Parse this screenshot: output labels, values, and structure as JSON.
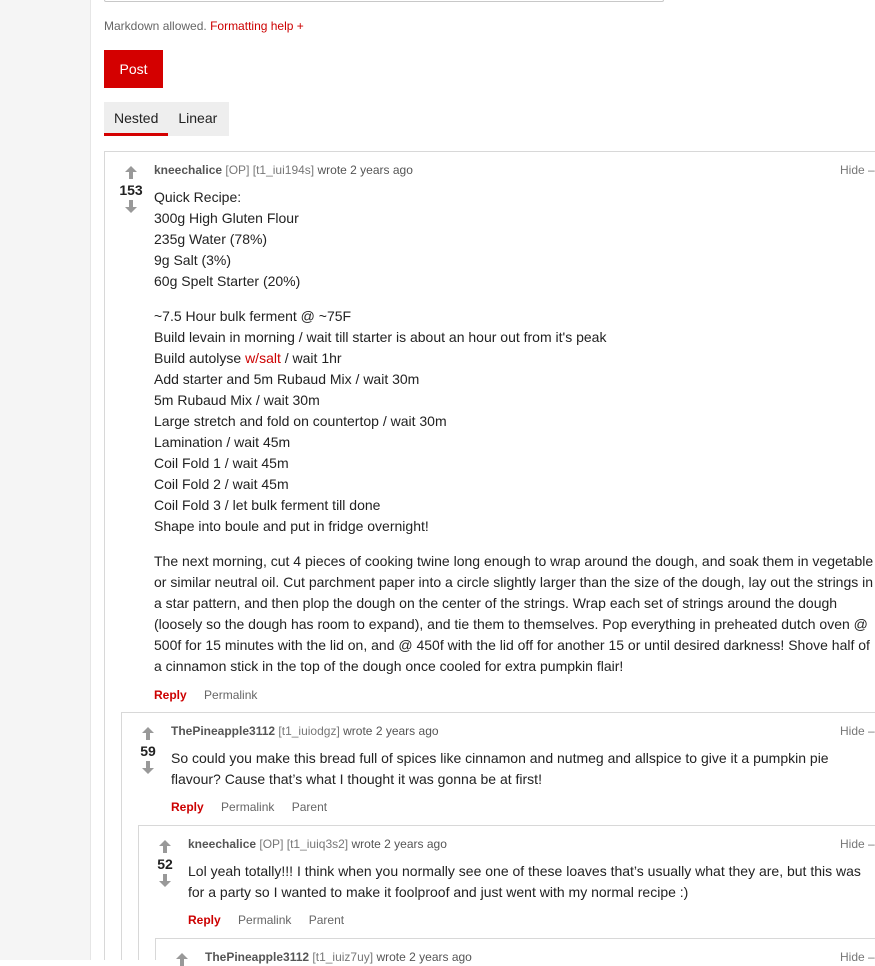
{
  "editor": {
    "markdown_note": "Markdown allowed.",
    "formatting_help": "Formatting help +"
  },
  "post_button": "Post",
  "tabs": [
    {
      "label": "Nested",
      "active": true
    },
    {
      "label": "Linear",
      "active": false
    }
  ],
  "labels": {
    "wrote": "wrote",
    "hide": "Hide –",
    "reply": "Reply",
    "permalink": "Permalink",
    "parent": "Parent"
  },
  "comments": [
    {
      "author": "kneechalice",
      "op_tag": "[OP]",
      "id": "[t1_iui194s]",
      "time": "2 years ago",
      "score": "153",
      "lines": [
        "Quick Recipe:",
        "300g High Gluten Flour",
        "235g Water (78%)",
        "9g Salt (3%)",
        "60g Spelt Starter (20%)",
        "~7.5 Hour bulk ferment @ ~75F",
        "Build levain in morning / wait till starter is about an hour out from it's peak",
        "Build autolyse ",
        "w/salt",
        " / wait 1hr",
        "Add starter and 5m Rubaud Mix / wait 30m",
        "5m Rubaud Mix / wait 30m",
        "Large stretch and fold on countertop / wait 30m",
        "Lamination / wait 45m",
        "Coil Fold 1 / wait 45m",
        "Coil Fold 2 / wait 45m",
        "Coil Fold 3 / let bulk ferment till done",
        "Shape into boule and put in fridge overnight!",
        "The next morning, cut 4 pieces of cooking twine long enough to wrap around the dough, and soak them in vegetable or similar neutral oil. Cut parchment paper into a circle slightly larger than the size of the dough, lay out the strings in a star pattern, and then plop the dough on the center of the strings. Wrap each set of strings around the dough (loosely so the dough has room to expand), and tie them to themselves. Pop everything in preheated dutch oven @ 500f for 15 minutes with the lid on, and @ 450f with the lid off for another 15 or until desired darkness! Shove half of a cinnamon stick in the top of the dough once cooled for extra pumpkin flair!"
      ]
    },
    {
      "author": "ThePineapple3112",
      "id": "[t1_iuiodgz]",
      "time": "2 years ago",
      "score": "59",
      "text": "So could you make this bread full of spices like cinnamon and nutmeg and allspice to give it a pumpkin pie flavour? Cause that’s what I thought it was gonna be at first!"
    },
    {
      "author": "kneechalice",
      "op_tag": "[OP]",
      "id": "[t1_iuiq3s2]",
      "time": "2 years ago",
      "score": "52",
      "text": "Lol yeah totally!!! I think when you normally see one of these loaves that’s usually what they are, but this was for a party so I wanted to make it foolproof and just went with my normal recipe :)"
    },
    {
      "author": "ThePineapple3112",
      "id": "[t1_iuiz7uy]",
      "time": "2 years ago"
    }
  ],
  "colors": {
    "accent": "#d40000",
    "tab_bg": "#eeeeee",
    "gutter": "#f5f5f5"
  }
}
